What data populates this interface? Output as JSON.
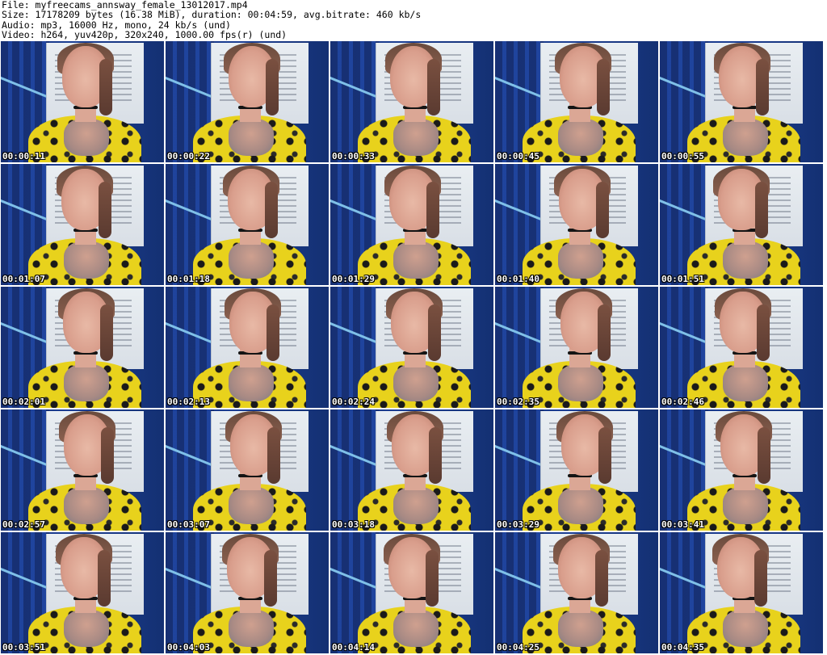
{
  "header": {
    "file": "File: myfreecams_annsway_female_13012017.mp4",
    "size": "Size: 17178209 bytes (16.38 MiB), duration: 00:04:59, avg.bitrate: 460 kb/s",
    "audio": "Audio: mp3, 16000 Hz, mono, 24 kb/s (und)",
    "video": "Video: h264, yuv420p, 320x240, 1000.00 fps(r) (und)"
  },
  "thumbnails": [
    {
      "time": "00:00:11"
    },
    {
      "time": "00:00:22"
    },
    {
      "time": "00:00:33"
    },
    {
      "time": "00:00:45"
    },
    {
      "time": "00:00:55"
    },
    {
      "time": "00:01:07"
    },
    {
      "time": "00:01:18"
    },
    {
      "time": "00:01:29"
    },
    {
      "time": "00:01:40"
    },
    {
      "time": "00:01:51"
    },
    {
      "time": "00:02:01"
    },
    {
      "time": "00:02:13"
    },
    {
      "time": "00:02:24"
    },
    {
      "time": "00:02:35"
    },
    {
      "time": "00:02:46"
    },
    {
      "time": "00:02:57"
    },
    {
      "time": "00:03:07"
    },
    {
      "time": "00:03:18"
    },
    {
      "time": "00:03:29"
    },
    {
      "time": "00:03:41"
    },
    {
      "time": "00:03:51"
    },
    {
      "time": "00:04:03"
    },
    {
      "time": "00:04:14"
    },
    {
      "time": "00:04:25"
    },
    {
      "time": "00:04:35"
    }
  ],
  "colors": {
    "background": "#ffffff",
    "curtain": "#1b3f95",
    "shirt": "#e8d21c",
    "timestamp": "#ffffff"
  }
}
